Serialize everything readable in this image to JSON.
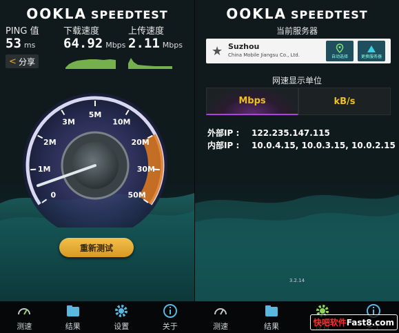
{
  "left": {
    "brand": {
      "ookla": "OOKLA",
      "speedtest": "SPEEDTEST"
    },
    "ping": {
      "label": "PING 值",
      "value": "53",
      "unit": "ms"
    },
    "download": {
      "label": "下载速度",
      "value": "64.92",
      "unit": "Mbps"
    },
    "upload": {
      "label": "上传速度",
      "value": "2.11",
      "unit": "Mbps"
    },
    "share_label": "分享",
    "gauge": {
      "ticks": [
        "0",
        "1M",
        "2M",
        "3M",
        "5M",
        "10M",
        "20M",
        "30M",
        "50M"
      ],
      "needle_value": 0.5
    },
    "retest_label": "重新测试",
    "tabs": [
      "测速",
      "结果",
      "设置",
      "关于"
    ]
  },
  "right": {
    "brand": {
      "ookla": "OOKLA",
      "speedtest": "SPEEDTEST"
    },
    "server_label": "当前服务器",
    "server": {
      "name": "Suzhou",
      "provider": "China Mobile Jiangsu Co., Ltd.",
      "btn_auto": "自动选择",
      "btn_change": "更换服务器"
    },
    "units_label": "网速显示单位",
    "units": [
      "Mbps",
      "kB/s"
    ],
    "external_ip": {
      "label": "外部IP  :",
      "value": "122.235.147.115"
    },
    "internal_ip": {
      "label": "内部IP  :",
      "value": "10.0.4.15, 10.0.3.15, 10.0.2.15"
    },
    "version": "3.2.14",
    "tabs": [
      "测速",
      "结果",
      "设置",
      "关于"
    ]
  },
  "watermark": {
    "left": "快吧软件",
    "right": "Fast8.com"
  },
  "colors": {
    "accent": "#f0c020",
    "purple": "#b040e0",
    "orange": "#e07a20",
    "teal": "#1e8a88"
  }
}
